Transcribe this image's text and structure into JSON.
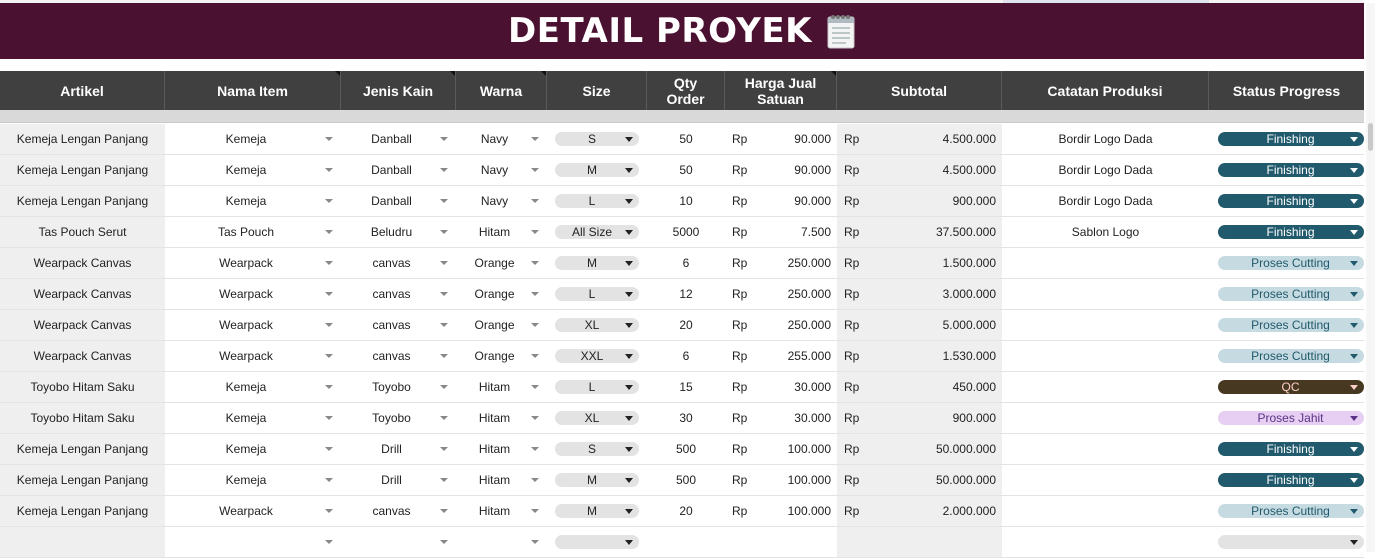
{
  "title": "DETAIL PROYEK",
  "headers": {
    "artikel": "Artikel",
    "nama_item": "Nama Item",
    "jenis_kain": "Jenis Kain",
    "warna": "Warna",
    "size": "Size",
    "qty": "Qty Order",
    "harga": "Harga Jual Satuan",
    "subtotal": "Subtotal",
    "catatan": "Catatan Produksi",
    "status": "Status Progress"
  },
  "currency": "Rp",
  "status_colors": {
    "Finishing": {
      "bg": "#215a6c",
      "fg": "#ffffff"
    },
    "Proses Cutting": {
      "bg": "#c6dbe1",
      "fg": "#215a6c"
    },
    "QC": {
      "bg": "#473821",
      "fg": "#ffcfc9"
    },
    "Proses Jahit": {
      "bg": "#e6cff2",
      "fg": "#5a3286"
    }
  },
  "rows": [
    {
      "artikel": "Kemeja Lengan Panjang",
      "nama": "Kemeja",
      "jenis": "Danball",
      "warna": "Navy",
      "size": "S",
      "qty": "50",
      "harga": "90.000",
      "subtotal": "4.500.000",
      "catatan": "Bordir Logo Dada",
      "status": "Finishing"
    },
    {
      "artikel": "Kemeja Lengan Panjang",
      "nama": "Kemeja",
      "jenis": "Danball",
      "warna": "Navy",
      "size": "M",
      "qty": "50",
      "harga": "90.000",
      "subtotal": "4.500.000",
      "catatan": "Bordir Logo Dada",
      "status": "Finishing"
    },
    {
      "artikel": "Kemeja Lengan Panjang",
      "nama": "Kemeja",
      "jenis": "Danball",
      "warna": "Navy",
      "size": "L",
      "qty": "10",
      "harga": "90.000",
      "subtotal": "900.000",
      "catatan": "Bordir Logo Dada",
      "status": "Finishing"
    },
    {
      "artikel": "Tas Pouch Serut",
      "nama": "Tas Pouch",
      "jenis": "Beludru",
      "warna": "Hitam",
      "size": "All Size",
      "qty": "5000",
      "harga": "7.500",
      "subtotal": "37.500.000",
      "catatan": "Sablon Logo",
      "status": "Finishing"
    },
    {
      "artikel": "Wearpack Canvas",
      "nama": "Wearpack",
      "jenis": "canvas",
      "warna": "Orange",
      "size": "M",
      "qty": "6",
      "harga": "250.000",
      "subtotal": "1.500.000",
      "catatan": "",
      "status": "Proses Cutting"
    },
    {
      "artikel": "Wearpack Canvas",
      "nama": "Wearpack",
      "jenis": "canvas",
      "warna": "Orange",
      "size": "L",
      "qty": "12",
      "harga": "250.000",
      "subtotal": "3.000.000",
      "catatan": "",
      "status": "Proses Cutting"
    },
    {
      "artikel": "Wearpack Canvas",
      "nama": "Wearpack",
      "jenis": "canvas",
      "warna": "Orange",
      "size": "XL",
      "qty": "20",
      "harga": "250.000",
      "subtotal": "5.000.000",
      "catatan": "",
      "status": "Proses Cutting"
    },
    {
      "artikel": "Wearpack Canvas",
      "nama": "Wearpack",
      "jenis": "canvas",
      "warna": "Orange",
      "size": "XXL",
      "qty": "6",
      "harga": "255.000",
      "subtotal": "1.530.000",
      "catatan": "",
      "status": "Proses Cutting"
    },
    {
      "artikel": "Toyobo Hitam Saku",
      "nama": "Kemeja",
      "jenis": "Toyobo",
      "warna": "Hitam",
      "size": "L",
      "qty": "15",
      "harga": "30.000",
      "subtotal": "450.000",
      "catatan": "",
      "status": "QC"
    },
    {
      "artikel": "Toyobo Hitam Saku",
      "nama": "Kemeja",
      "jenis": "Toyobo",
      "warna": "Hitam",
      "size": "XL",
      "qty": "30",
      "harga": "30.000",
      "subtotal": "900.000",
      "catatan": "",
      "status": "Proses Jahit"
    },
    {
      "artikel": "Kemeja Lengan Panjang",
      "nama": "Kemeja",
      "jenis": "Drill",
      "warna": "Hitam",
      "size": "S",
      "qty": "500",
      "harga": "100.000",
      "subtotal": "50.000.000",
      "catatan": "",
      "status": "Finishing"
    },
    {
      "artikel": "Kemeja Lengan Panjang",
      "nama": "Kemeja",
      "jenis": "Drill",
      "warna": "Hitam",
      "size": "M",
      "qty": "500",
      "harga": "100.000",
      "subtotal": "50.000.000",
      "catatan": "",
      "status": "Finishing"
    },
    {
      "artikel": "Kemeja Lengan Panjang",
      "nama": "Wearpack",
      "jenis": "canvas",
      "warna": "Hitam",
      "size": "M",
      "qty": "20",
      "harga": "100.000",
      "subtotal": "2.000.000",
      "catatan": "",
      "status": "Proses Cutting"
    },
    {
      "artikel": "",
      "nama": "",
      "jenis": "",
      "warna": "",
      "size": "",
      "qty": "",
      "harga": "",
      "subtotal": "",
      "catatan": "",
      "status": ""
    }
  ]
}
